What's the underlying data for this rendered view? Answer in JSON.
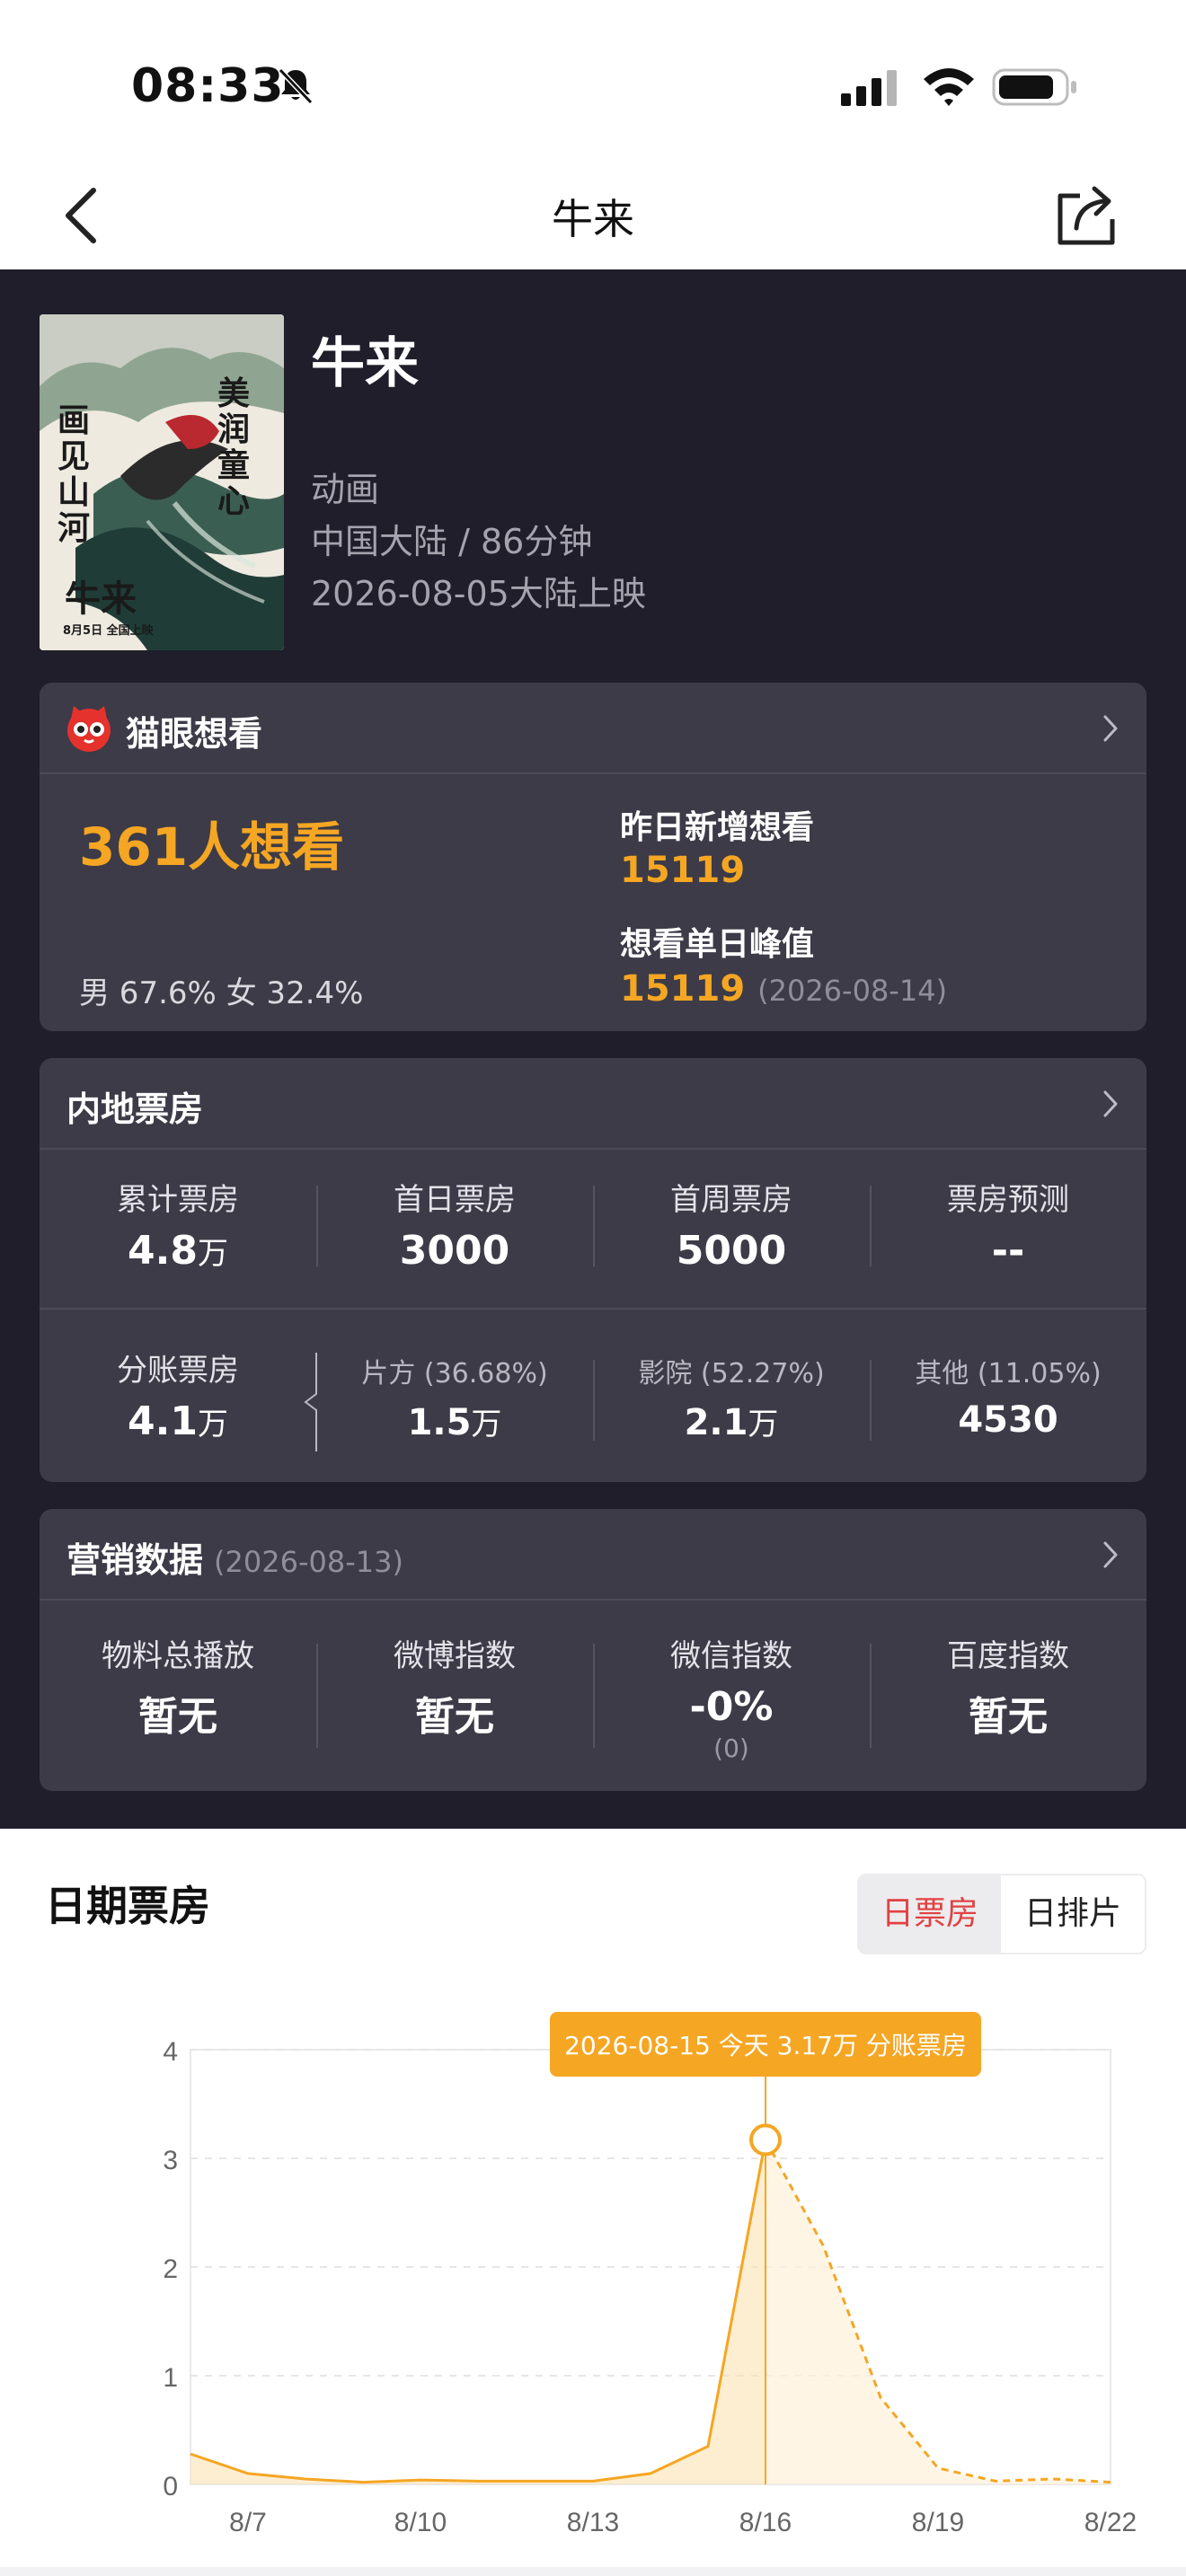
{
  "status_bar": {
    "time": "08:33"
  },
  "nav": {
    "title": "牛来"
  },
  "movie": {
    "title": "牛来",
    "genre": "动画",
    "region_duration": "中国大陆 / 86分钟",
    "release": "2026-08-05大陆上映",
    "poster_text": [
      "画见山河",
      "美润童心",
      "牛来",
      "8月5日 全国上映"
    ]
  },
  "want": {
    "header": "猫眼想看",
    "count": "361人想看",
    "gender": "男 67.6% 女 32.4%",
    "yesterday_label": "昨日新增想看",
    "yesterday_value": "15119",
    "peak_label": "想看单日峰值",
    "peak_value": "15119",
    "peak_date": "(2026-08-14)"
  },
  "boxoffice": {
    "header": "内地票房",
    "row1": [
      {
        "label": "累计票房",
        "value": "4.8",
        "unit": "万"
      },
      {
        "label": "首日票房",
        "value": "3000",
        "unit": ""
      },
      {
        "label": "首周票房",
        "value": "5000",
        "unit": ""
      },
      {
        "label": "票房预测",
        "value": "--",
        "unit": ""
      }
    ],
    "row2": [
      {
        "label": "分账票房",
        "value": "4.1",
        "unit": "万"
      },
      {
        "label": "片方 (36.68%)",
        "value": "1.5",
        "unit": "万"
      },
      {
        "label": "影院 (52.27%)",
        "value": "2.1",
        "unit": "万"
      },
      {
        "label": "其他 (11.05%)",
        "value": "4530",
        "unit": ""
      }
    ]
  },
  "marketing": {
    "header": "营销数据",
    "date": "(2026-08-13)",
    "items": [
      {
        "label": "物料总播放",
        "value": "暂无",
        "sub": ""
      },
      {
        "label": "微博指数",
        "value": "暂无",
        "sub": ""
      },
      {
        "label": "微信指数",
        "value": "-0%",
        "sub": "(0)"
      },
      {
        "label": "百度指数",
        "value": "暂无",
        "sub": ""
      }
    ]
  },
  "daily": {
    "title": "日期票房",
    "tab_active": "日票房",
    "tab_other": "日排片",
    "tooltip": "2026-08-15 今天 3.17万 分账票房"
  },
  "colors": {
    "accent": "#f5a623",
    "dark_bg": "#1f1e2a",
    "card_bg": "#3c3b47",
    "active_tab": "#e24141"
  },
  "chart_data": {
    "type": "line",
    "x": [
      "8/6",
      "8/7",
      "8/8",
      "8/9",
      "8/10",
      "8/11",
      "8/12",
      "8/13",
      "8/14",
      "8/15",
      "8/16",
      "8/17",
      "8/18",
      "8/19",
      "8/20",
      "8/21",
      "8/22"
    ],
    "x_tick_labels": [
      "8/7",
      "8/10",
      "8/13",
      "8/16",
      "8/19",
      "8/22"
    ],
    "series": [
      {
        "values": [
          0.28,
          0.1,
          0.05,
          0.02,
          0.04,
          0.03,
          0.03,
          0.03,
          0.1,
          0.35,
          3.17,
          2.2,
          0.8,
          0.15,
          0.03,
          0.05,
          0.02
        ]
      }
    ],
    "actual_count": 10,
    "highlight_index": 10,
    "ylim": [
      0,
      4
    ],
    "yticks": [
      0,
      1,
      2,
      3,
      4
    ],
    "grid": true
  }
}
